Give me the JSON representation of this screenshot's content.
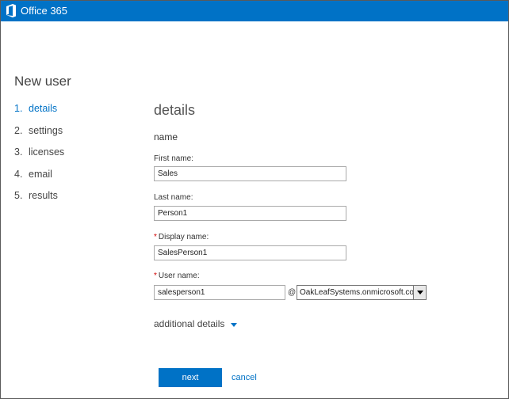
{
  "app": {
    "brand": "Office 365",
    "brand_icon": "office-logo-icon",
    "accent": "#0072c6"
  },
  "page": {
    "title": "New user"
  },
  "steps": [
    {
      "num": "1.",
      "label": "details",
      "active": true
    },
    {
      "num": "2.",
      "label": "settings",
      "active": false
    },
    {
      "num": "3.",
      "label": "licenses",
      "active": false
    },
    {
      "num": "4.",
      "label": "email",
      "active": false
    },
    {
      "num": "5.",
      "label": "results",
      "active": false
    }
  ],
  "form": {
    "section_title": "details",
    "subhead": "name",
    "first_name": {
      "label": "First name:",
      "value": "Sales"
    },
    "last_name": {
      "label": "Last name:",
      "value": "Person1"
    },
    "display_name": {
      "required_mark": "*",
      "label": "Display name:",
      "value": "SalesPerson1"
    },
    "user_name": {
      "required_mark": "*",
      "label": "User name:",
      "value": "salesperson1"
    },
    "at_sign": "@",
    "domain": {
      "value": "OakLeafSystems.onmicrosoft.com"
    },
    "additional_details": "additional details"
  },
  "actions": {
    "next_label": "next",
    "cancel_label": "cancel"
  }
}
